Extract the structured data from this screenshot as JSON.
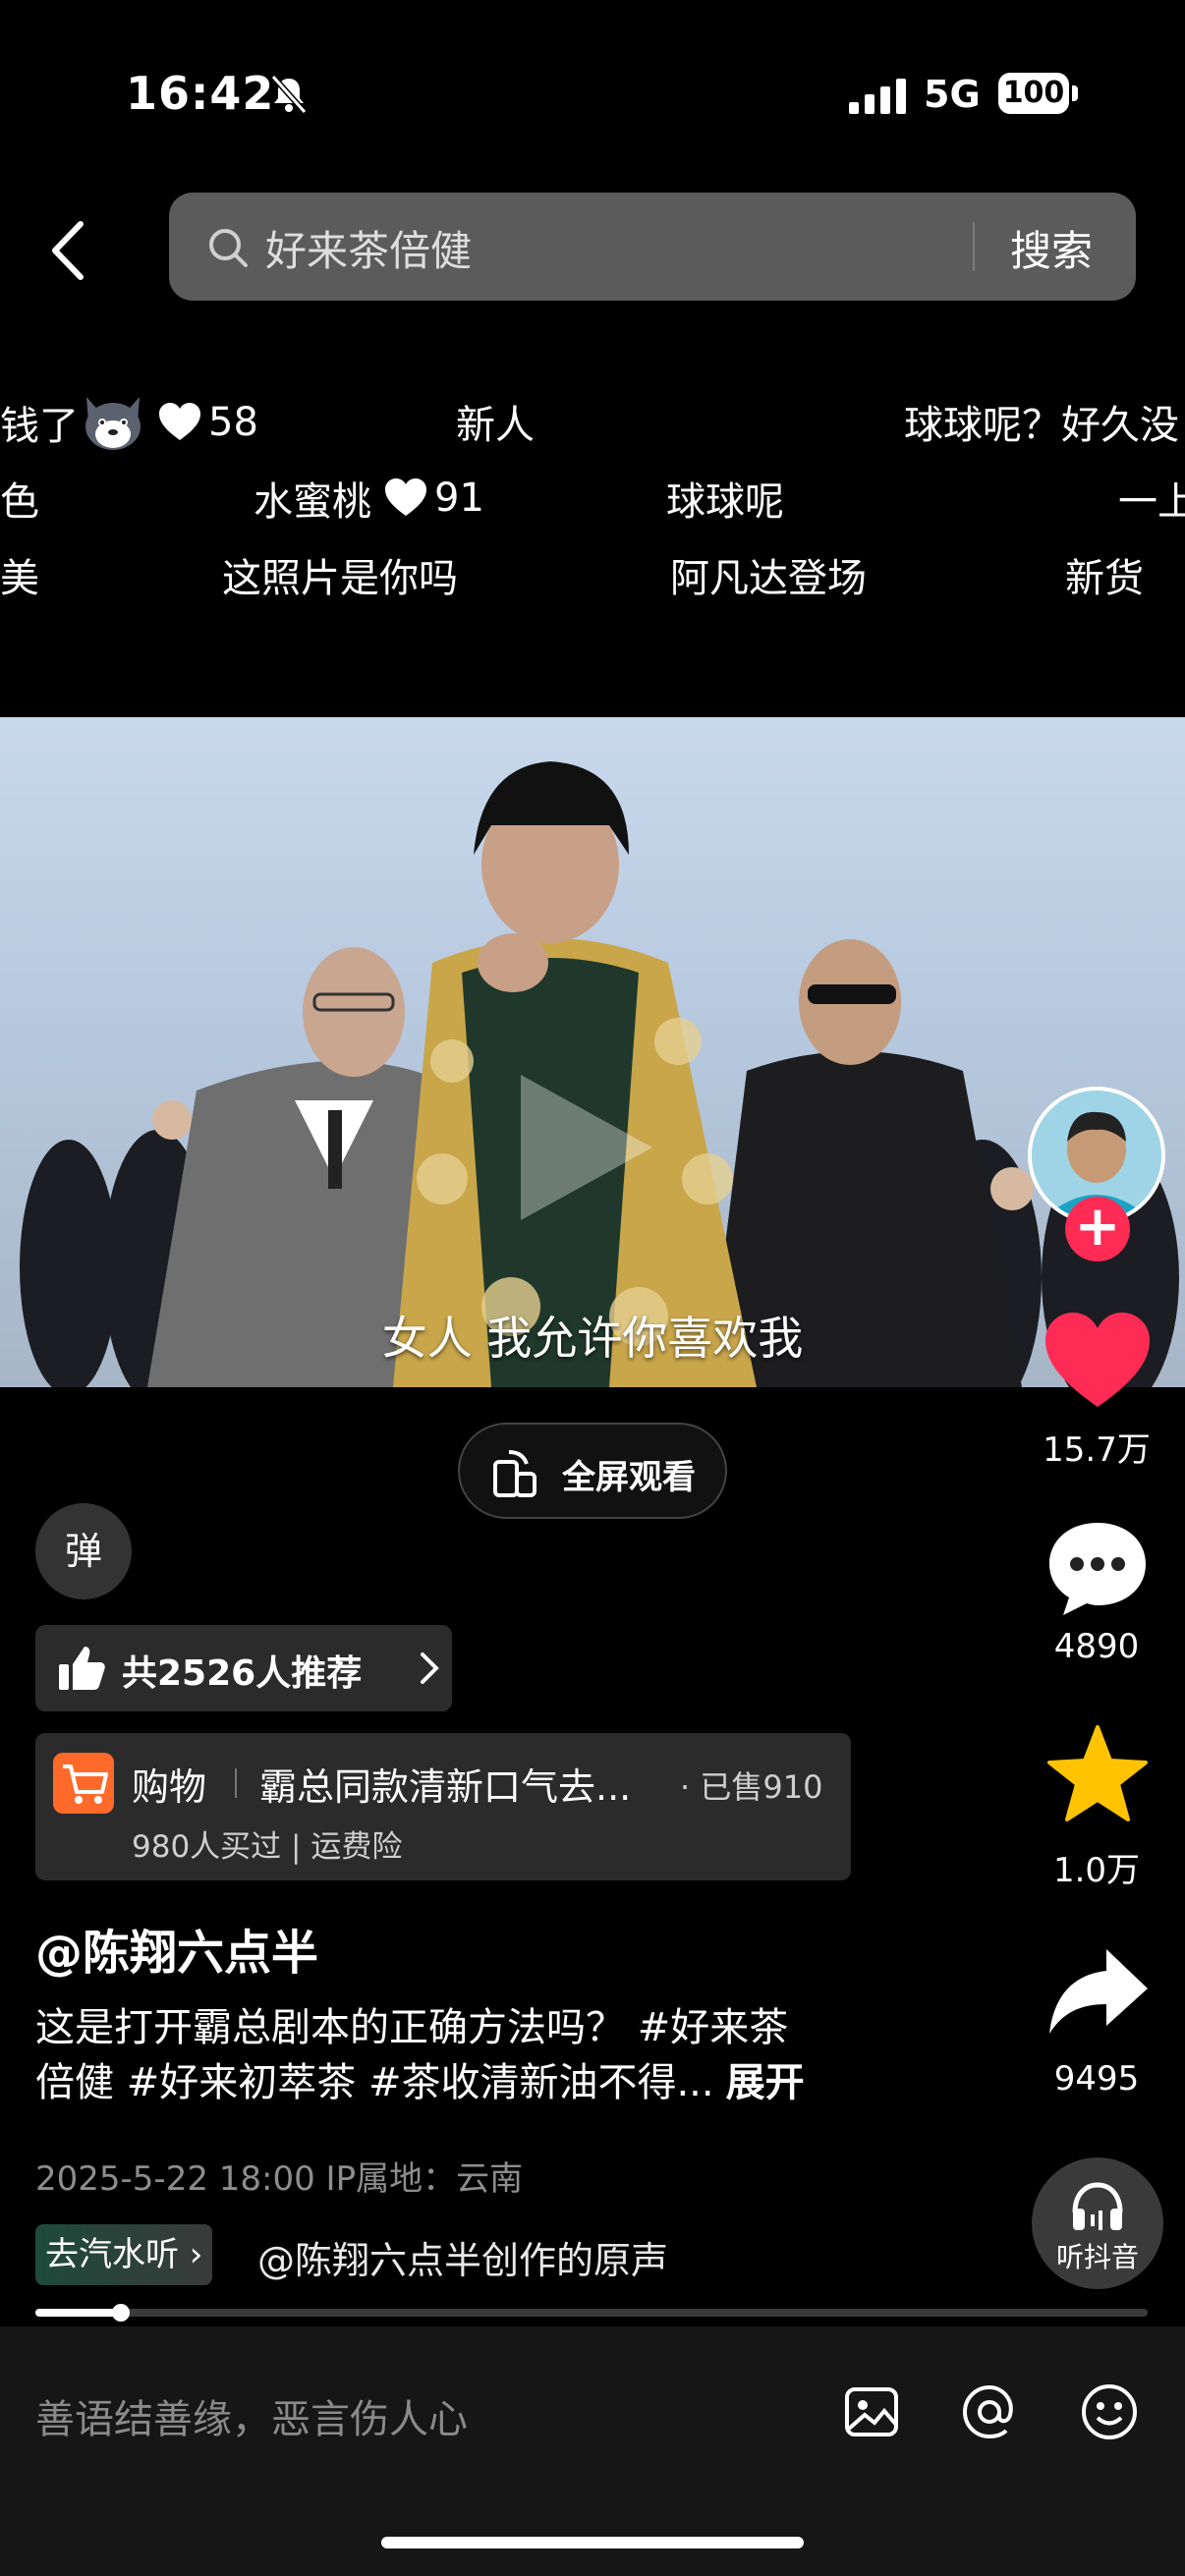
{
  "status": {
    "time": "16:42",
    "network": "5G",
    "battery": "100"
  },
  "search": {
    "query": "好来茶倍健",
    "button": "搜索"
  },
  "danmaku": [
    {
      "text": "钱了",
      "likes": "58"
    },
    {
      "text": "新人"
    },
    {
      "text": "球球呢？好久没"
    },
    {
      "text": "色"
    },
    {
      "text": "水蜜桃",
      "likes": "91"
    },
    {
      "text": "球球呢"
    },
    {
      "text": "一上"
    },
    {
      "text": "美"
    },
    {
      "text": "这照片是你吗"
    },
    {
      "text": "阿凡达登场"
    },
    {
      "text": "新货"
    }
  ],
  "video": {
    "subtitle": "女人 我允许你喜欢我"
  },
  "rail": {
    "likes": "15.7万",
    "comments": "4890",
    "favorites": "1.0万",
    "shares": "9495",
    "listen": "听抖音"
  },
  "fullscreen_label": "全屏观看",
  "danmu_toggle": "弹",
  "recommend": "共2526人推荐",
  "shop": {
    "tag": "购物",
    "title": "霸总同款清新口气去...",
    "sold": "· 已售910",
    "sub": "980人买过 | 运费险"
  },
  "post": {
    "author": "@陈翔六点半",
    "desc_line1": "这是打开霸总剧本的正确方法吗？ #好来茶",
    "desc_line2": "倍健 #好来初萃茶 #茶收清新油不得...",
    "more": "展开",
    "meta": "2025-5-22 18:00   IP属地：云南"
  },
  "music": {
    "tag": "去汽水听",
    "text": "@陈翔六点半创作的原声"
  },
  "progress": {
    "played_fraction": 0.077
  },
  "comment": {
    "placeholder": "善语结善缘，恶言伤人心"
  },
  "colors": {
    "accent_red": "#fe2c55",
    "star_yellow": "#ffc300",
    "cart_orange": "#ff6a2b"
  }
}
